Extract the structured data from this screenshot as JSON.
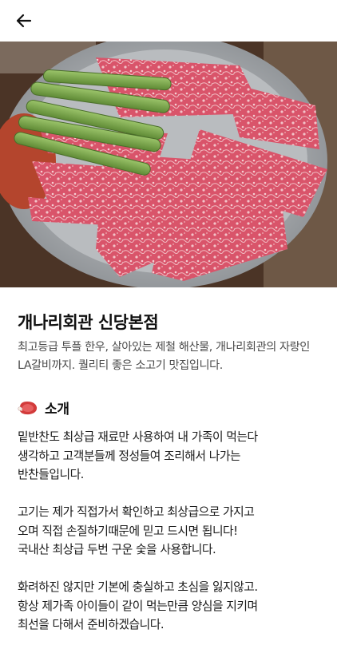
{
  "header": {
    "back_icon": "arrow-left-icon"
  },
  "hero": {
    "image_description_icon": "photo"
  },
  "store": {
    "name": "개나리회관 신당본점",
    "description": "최고등급 투플 한우, 살아있는 제철 해산물, 개나리회관의 자랑인 LA갈비까지. 퀄리티 좋은 소고기 맛집입니다."
  },
  "intro": {
    "icon": "meat-icon",
    "title": "소개",
    "paragraphs": [
      "밑반찬도 최상급 재료만 사용하여 내 가족이 먹는다\n생각하고 고객분들께 정성들여 조리해서 나가는\n반찬들입니다.",
      "고기는 제가 직접가서 확인하고 최상급으로 가지고\n오며 직접 손질하기때문에 믿고 드시면 됩니다!\n국내산 최상급 두번 구운 숯을 사용합니다.",
      "화려하진 않지만 기본에 충실하고 초심을 잃지않고.\n항상 제가족 아이들이 같이 먹는만큼 양심을 지키며\n최선을 다해서 준비하겠습니다."
    ]
  },
  "colors": {
    "accent": "#c0392b",
    "text_secondary": "#4a4a4a"
  }
}
